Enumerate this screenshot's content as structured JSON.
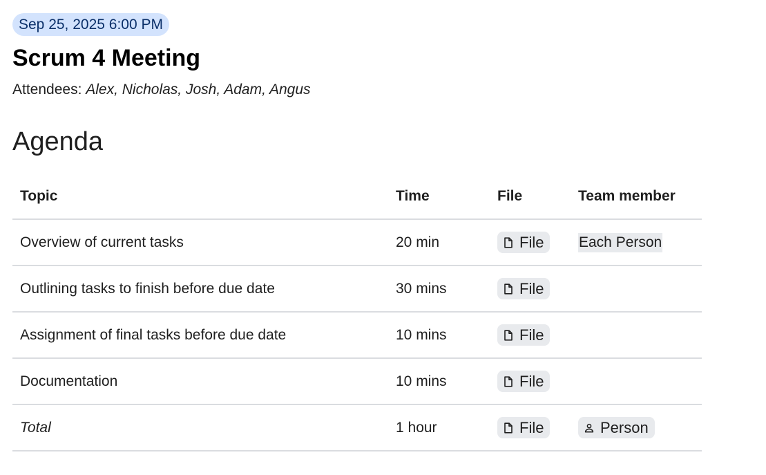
{
  "event": {
    "date_chip": "Sep 25, 2025 6:00 PM",
    "title": "Scrum 4 Meeting",
    "attendees_label": "Attendees:",
    "attendees_names": "Alex, Nicholas, Josh, Adam, Angus"
  },
  "agenda": {
    "heading": "Agenda",
    "columns": [
      "Topic",
      "Time",
      "File",
      "Team member"
    ],
    "rows": [
      {
        "topic": "Overview of current tasks",
        "time": "20 min",
        "file": "File",
        "member": "Each Person"
      },
      {
        "topic": "Outlining tasks to finish before due date",
        "time": "30 mins",
        "file": "File",
        "member": ""
      },
      {
        "topic": "Assignment of final tasks before due date",
        "time": "10 mins",
        "file": "File",
        "member": ""
      },
      {
        "topic": "Documentation",
        "time": "10 mins",
        "file": "File",
        "member": ""
      },
      {
        "topic": "Total",
        "time": "1 hour",
        "file": "File",
        "member": "Person"
      }
    ]
  },
  "icons": {
    "file_chip": "file-icon",
    "person_chip": "person-icon"
  },
  "colors": {
    "date_chip_bg": "#d3e3fd",
    "date_chip_text": "#0b3069",
    "smart_chip_bg": "#e8eaed",
    "divider": "#dadce0"
  }
}
